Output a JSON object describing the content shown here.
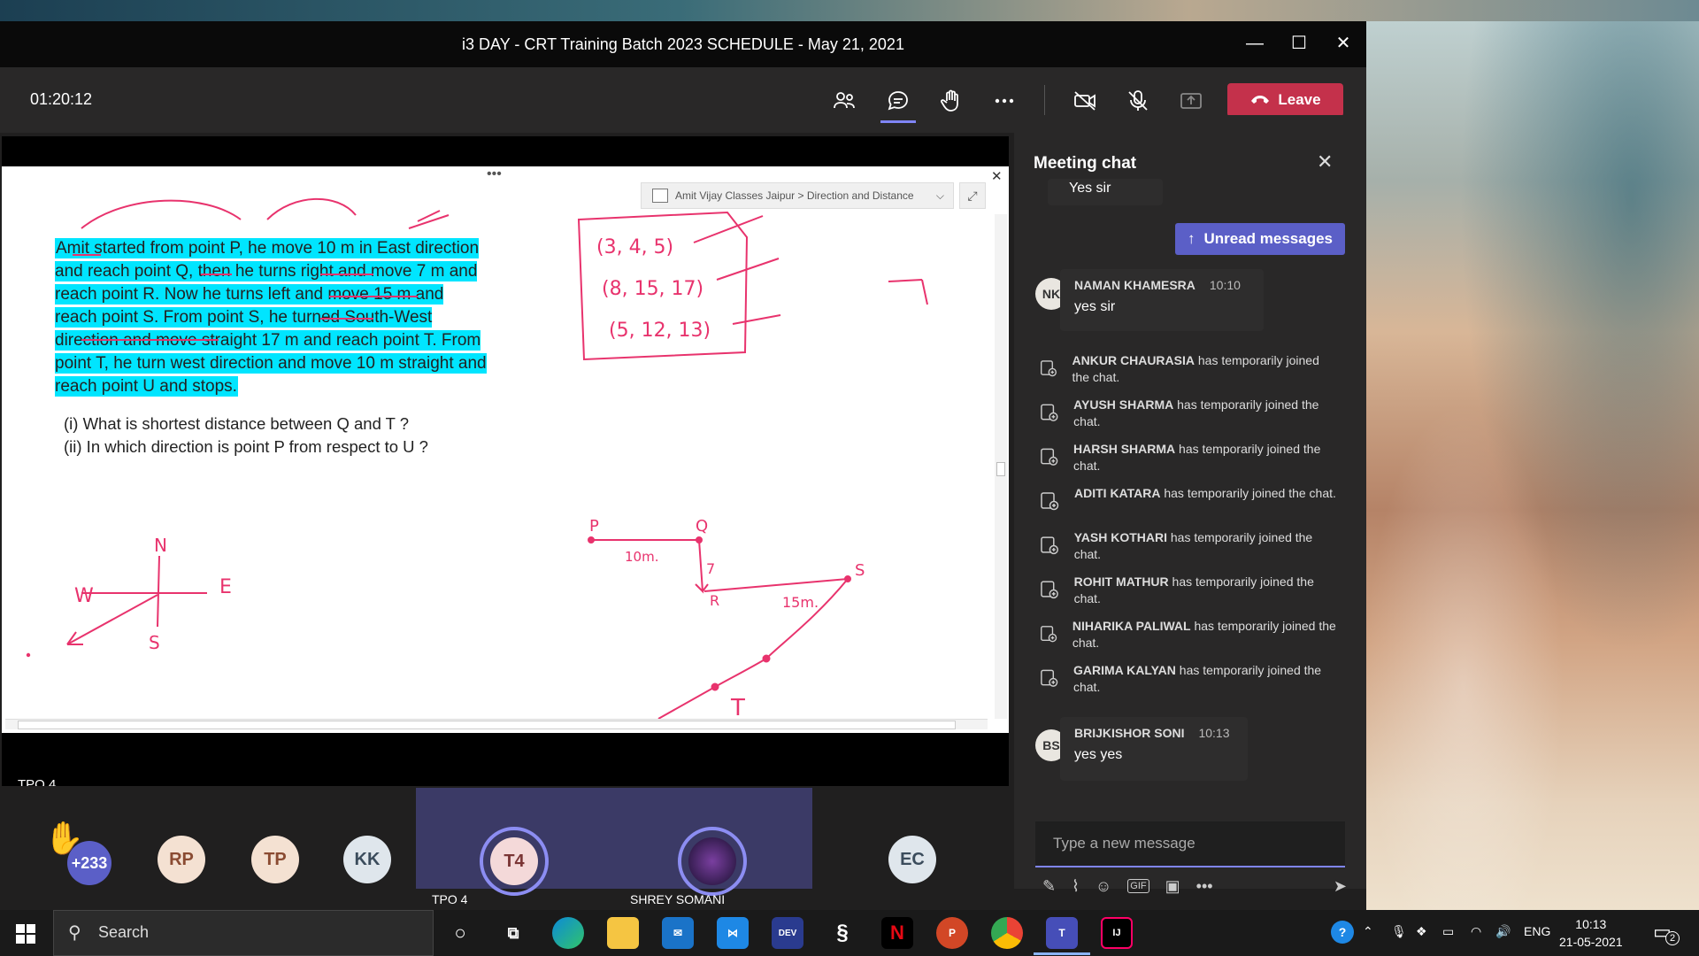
{
  "window": {
    "title": "i3 DAY - CRT Training Batch 2023 SCHEDULE - May 21, 2021",
    "minimize": "—",
    "maximize": "☐",
    "close": "✕"
  },
  "toolbar": {
    "timer": "01:20:12",
    "icons": [
      "participants-icon",
      "chat-icon",
      "raise-hand-icon",
      "more-icon",
      "camera-off-icon",
      "mic-off-icon",
      "share-tray-icon"
    ],
    "leave_label": "Leave",
    "leave_color": "#c4314b"
  },
  "share": {
    "breadcrumb": "Amit Vijay Classes Jaipur > Direction and Distance",
    "problem_text": "Amit started from point P, he move 10 m in East direction and reach point Q, then he turns right and move 7 m and reach point R. Now he turns left and move 15 m and reach point S. From point S, he turned South-West direction and move straight 17 m and reach point T. From point T, he turn west direction and move 10 m straight and reach point U and stops.",
    "q1": "(i) What is shortest distance between Q and T ?",
    "q2": "(ii) In which direction is point P from respect to U ?",
    "ink_triples": [
      "(3, 4, 5)",
      "(8, 15, 17)",
      "(5, 12, 13)"
    ],
    "ink_labels": {
      "p": "P",
      "q": "Q",
      "r": "R",
      "s": "S",
      "t": "T",
      "d1": "10m.",
      "d2": "7",
      "d3": "15m.",
      "n": "N",
      "e": "E",
      "w": "W",
      "south": "S"
    },
    "highlight_color": "#00e5ff",
    "ink_color": "#e8336d"
  },
  "stage": {
    "presenter_label": "TPO 4"
  },
  "strip": {
    "hand_count": "+233",
    "avatars": [
      "RP",
      "TP",
      "KK",
      "EC"
    ],
    "tile1_initials": "T4",
    "tile1_name": "TPO 4",
    "tile2_name": "SHREY SOMANI"
  },
  "chat": {
    "title": "Meeting chat",
    "unread_label": "Unread messages",
    "partial_message": "Yes sir",
    "msg1": {
      "initials": "NK",
      "name": "NAMAN KHAMESRA",
      "time": "10:10",
      "text": "yes sir"
    },
    "system": [
      {
        "name": "ANKUR CHAURASIA",
        "rest": "has temporarily joined the chat."
      },
      {
        "name": "AYUSH SHARMA",
        "rest": "has temporarily joined the chat."
      },
      {
        "name": "HARSH SHARMA",
        "rest": "has temporarily joined the chat."
      },
      {
        "name": "ADITI KATARA",
        "rest": "has temporarily joined the chat."
      },
      {
        "name": "YASH KOTHARI",
        "rest": "has temporarily joined the chat."
      },
      {
        "name": "ROHIT MATHUR",
        "rest": "has temporarily joined the chat."
      },
      {
        "name": "NIHARIKA PALIWAL",
        "rest": "has temporarily joined the chat."
      },
      {
        "name": "GARIMA KALYAN",
        "rest": "has temporarily joined the chat."
      }
    ],
    "msg2": {
      "initials": "BS",
      "name": "BRIJKISHOR SONI",
      "time": "10:13",
      "text": "yes yes"
    },
    "compose_placeholder": "Type a new message",
    "compose_tools": [
      "format-icon",
      "attach-icon",
      "emoji-icon",
      "gif-icon",
      "sticker-icon",
      "more-icon"
    ],
    "send_icon": "send-icon"
  },
  "taskbar": {
    "search_label": "Search",
    "apps": [
      "cortana",
      "task-view",
      "edge",
      "explorer",
      "mail",
      "vscode",
      "devcpp",
      "vs-installer",
      "netflix",
      "powerpoint",
      "chrome",
      "teams",
      "intellij"
    ],
    "lang": "ENG",
    "time": "10:13",
    "date": "21-05-2021",
    "notifications": "2"
  }
}
